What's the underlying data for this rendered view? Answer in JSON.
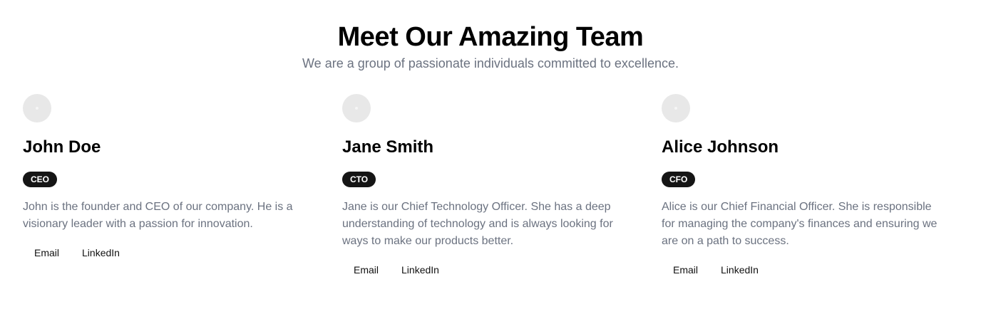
{
  "header": {
    "title": "Meet Our Amazing Team",
    "subtitle": "We are a group of passionate individuals committed to excellence."
  },
  "team": [
    {
      "name": "John Doe",
      "role": "CEO",
      "bio": "John is the founder and CEO of our company. He is a visionary leader with a passion for innovation.",
      "email_label": "Email",
      "linkedin_label": "LinkedIn"
    },
    {
      "name": "Jane Smith",
      "role": "CTO",
      "bio": "Jane is our Chief Technology Officer. She has a deep understanding of technology and is always looking for ways to make our products better.",
      "email_label": "Email",
      "linkedin_label": "LinkedIn"
    },
    {
      "name": "Alice Johnson",
      "role": "CFO",
      "bio": "Alice is our Chief Financial Officer. She is responsible for managing the company's finances and ensuring we are on a path to success.",
      "email_label": "Email",
      "linkedin_label": "LinkedIn"
    }
  ],
  "colors": {
    "title": "#000000",
    "subtitle": "#6b7280",
    "badge_background": "#151515",
    "avatar": "#e8e8e8"
  }
}
